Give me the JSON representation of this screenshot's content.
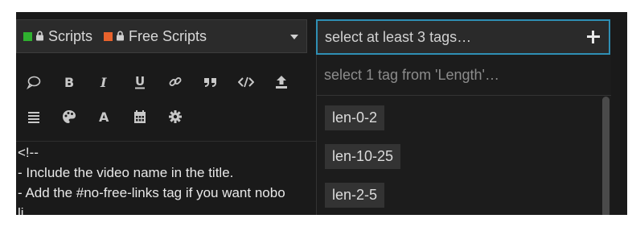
{
  "category": {
    "items": [
      {
        "label": "Scripts",
        "color": "#2fb02f"
      },
      {
        "label": "Free Scripts",
        "color": "#e8622c"
      }
    ]
  },
  "toolbar": {
    "row1": [
      "speech-bubble-icon",
      "bold-icon",
      "italic-icon",
      "underline-icon",
      "link-icon",
      "quote-icon",
      "code-icon",
      "upload-icon"
    ],
    "row2": [
      "list-icon",
      "palette-icon",
      "font-icon",
      "calendar-icon",
      "gear-icon"
    ]
  },
  "editor": {
    "lines": [
      "<!--",
      "- Include the video name in the title.",
      "- Add the #no-free-links tag if you want nobo",
      "  li..."
    ]
  },
  "tags": {
    "placeholder": "select at least 3 tags…",
    "hint": "select 1 tag from 'Length'…",
    "options": [
      "len-0-2",
      "len-10-25",
      "len-2-5"
    ]
  },
  "colors": {
    "accent": "#2f8fb4"
  }
}
